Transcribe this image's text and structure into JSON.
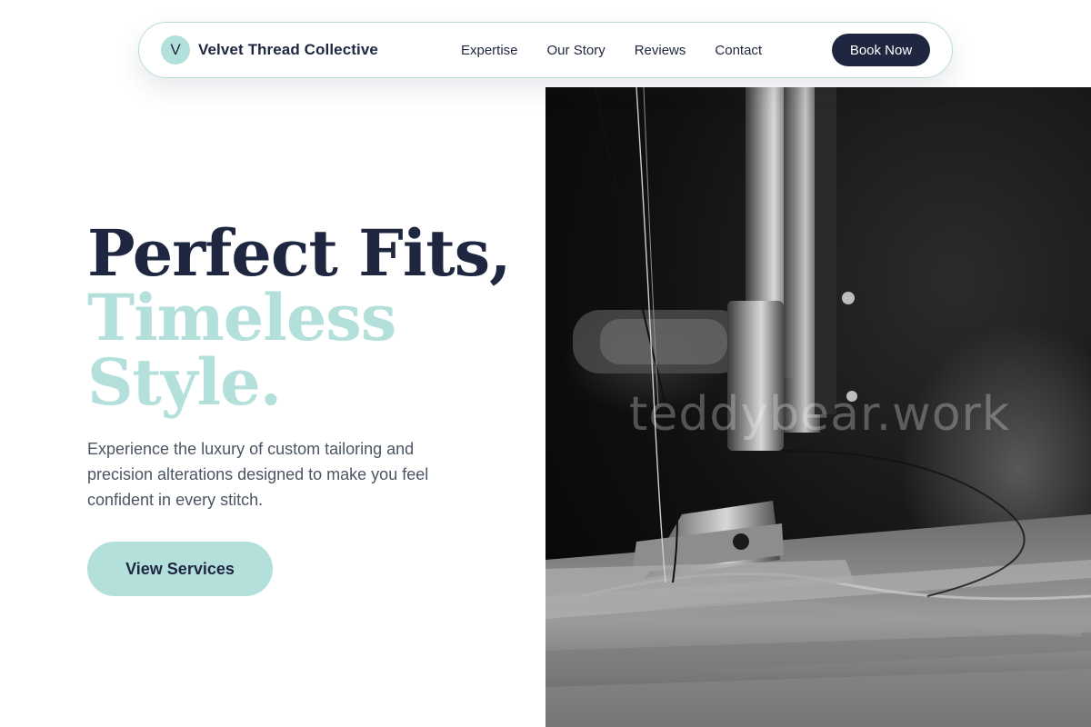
{
  "nav": {
    "logo_letter": "V",
    "brand_name": "Velvet Thread Collective",
    "links": [
      "Expertise",
      "Our Story",
      "Reviews",
      "Contact"
    ],
    "cta_label": "Book Now"
  },
  "hero": {
    "title_line1": "Perfect Fits,",
    "title_line2": "Timeless",
    "title_line3": "Style.",
    "description": "Experience the luxury of custom tailoring and precision alterations designed to make you feel confident in every stitch.",
    "cta_label": "View Services"
  },
  "image": {
    "subject": "sewing-machine-closeup",
    "watermark": "teddybear.work"
  },
  "colors": {
    "navy": "#1e2640",
    "teal": "#b4e0dc",
    "text_muted": "#4b5563",
    "nav_border": "#b8ddd9"
  }
}
